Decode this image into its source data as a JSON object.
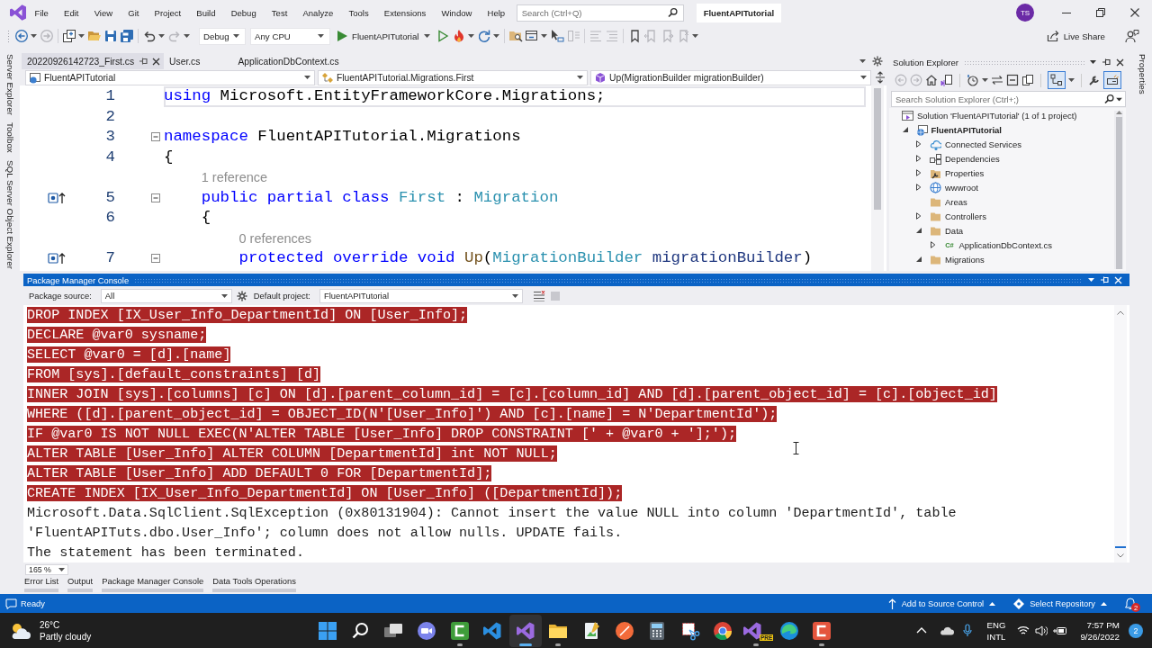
{
  "menu_bar": {
    "items": [
      "File",
      "Edit",
      "View",
      "Git",
      "Project",
      "Build",
      "Debug",
      "Test",
      "Analyze",
      "Tools",
      "Extensions",
      "Window",
      "Help"
    ],
    "search": {
      "placeholder": "Search (Ctrl+Q)"
    },
    "solution_name": "FluentAPITutorial",
    "account_initials": "TS"
  },
  "toolbar": {
    "back_button": {
      "disabled": false
    },
    "forward_button": {
      "disabled": true
    },
    "undo_button": {
      "disabled": false
    },
    "redo_button": {
      "disabled": true
    },
    "configuration": "Debug",
    "platform": "Any CPU",
    "startup_project": "FluentAPITutorial",
    "comment_buttons": [
      {
        "disabled": true
      },
      {
        "disabled": true
      }
    ],
    "bookmark_buttons": [
      {
        "disabled": false
      },
      {
        "disabled": true
      },
      {
        "disabled": true
      },
      {
        "disabled": true
      }
    ],
    "live_share": "Live Share"
  },
  "left_tool_strip": [
    "Server Explorer",
    "Toolbox",
    "SQL Server Object Explorer"
  ],
  "editor": {
    "tabs": [
      {
        "label": "20220926142723_First.cs",
        "selected": true
      },
      {
        "label": "User.cs",
        "selected": false
      },
      {
        "label": "ApplicationDbContext.cs",
        "selected": false
      }
    ],
    "navigation": [
      {
        "kind": "project",
        "text": "FluentAPITutorial"
      },
      {
        "kind": "class",
        "text": "FluentAPITutorial.Migrations.First"
      },
      {
        "kind": "method",
        "text": "Up(MigrationBuilder migrationBuilder)"
      }
    ],
    "lines": [
      {
        "kind": "code",
        "number": "1",
        "current": true,
        "glyph": false,
        "tokens": [
          {
            "kind": "keyword",
            "text": "using"
          },
          {
            "kind": "plain",
            "text": " Microsoft.EntityFrameworkCore.Migrations;"
          }
        ]
      },
      {
        "kind": "code",
        "number": "2",
        "current": false,
        "glyph": false
      },
      {
        "kind": "code",
        "number": "3",
        "current": false,
        "glyph": false,
        "expanded": true,
        "tokens": [
          {
            "kind": "keyword",
            "text": "namespace"
          },
          {
            "kind": "plain",
            "text": " FluentAPITutorial.Migrations"
          }
        ]
      },
      {
        "kind": "code",
        "number": "4",
        "current": false,
        "glyph": false,
        "tokens": [
          {
            "kind": "plain",
            "text": "{"
          }
        ]
      },
      {
        "kind": "codelens",
        "text": "    1 reference"
      },
      {
        "kind": "code",
        "number": "5",
        "current": false,
        "glyph": true,
        "expanded": true,
        "tokens": [
          {
            "kind": "keyword",
            "text": "    public partial class"
          },
          {
            "kind": "type",
            "text": " First"
          },
          {
            "kind": "plain",
            "text": " : "
          },
          {
            "kind": "type",
            "text": "Migration"
          }
        ]
      },
      {
        "kind": "code",
        "number": "6",
        "current": false,
        "glyph": false,
        "tokens": [
          {
            "kind": "plain",
            "text": "    {"
          }
        ]
      },
      {
        "kind": "codelens",
        "text": "        0 references"
      },
      {
        "kind": "code",
        "number": "7",
        "current": false,
        "glyph": true,
        "expanded": true,
        "tokens": [
          {
            "kind": "keyword",
            "text": "        protected override void"
          },
          {
            "kind": "method",
            "text": " Up"
          },
          {
            "kind": "plain",
            "text": "("
          },
          {
            "kind": "type",
            "text": "MigrationBuilder"
          },
          {
            "kind": "param",
            "text": " migrationBuilder"
          },
          {
            "kind": "plain",
            "text": ")"
          }
        ]
      }
    ]
  },
  "solution_explorer": {
    "title": "Solution Explorer",
    "toolbar": {
      "back_button": {
        "disabled": true
      },
      "forward_button": {
        "disabled": true
      },
      "toggle_buttons": [
        {
          "on": true
        },
        {
          "on": true
        }
      ]
    },
    "search": {
      "placeholder": "Search Solution Explorer (Ctrl+;)"
    },
    "tree": [
      {
        "kind": "solution",
        "label": "Solution 'FluentAPITutorial' (1 of 1 project)",
        "children": [
          {
            "kind": "project",
            "label": "FluentAPITutorial",
            "startup": true,
            "expanded": true,
            "children": [
              {
                "kind": "services",
                "label": "Connected Services",
                "expanded": false
              },
              {
                "kind": "dependencies",
                "label": "Dependencies",
                "expanded": false
              },
              {
                "kind": "properties",
                "label": "Properties",
                "expanded": false
              },
              {
                "kind": "webroot",
                "label": "wwwroot",
                "expanded": false
              },
              {
                "kind": "folder",
                "label": "Areas"
              },
              {
                "kind": "folder",
                "label": "Controllers",
                "expanded": false
              },
              {
                "kind": "folder",
                "label": "Data",
                "expanded": true,
                "children": [
                  {
                    "kind": "csharp",
                    "label": "ApplicationDbContext.cs",
                    "file_badge": "C#",
                    "expanded": false
                  }
                ]
              },
              {
                "kind": "folder",
                "label": "Migrations",
                "expanded": true
              }
            ]
          }
        ]
      }
    ]
  },
  "right_tool_strip": [
    "Properties"
  ],
  "package_manager_console": {
    "title": "Package Manager Console",
    "package_source_label": "Package source:",
    "package_source": "All",
    "default_project_label": "Default project:",
    "default_project": "FluentAPITutorial",
    "stop_button": {
      "disabled": true
    },
    "output": [
      {
        "highlighted": true,
        "text": "DROP INDEX [IX_User_Info_DepartmentId] ON [User_Info];"
      },
      {
        "highlighted": true,
        "text": "DECLARE @var0 sysname;"
      },
      {
        "highlighted": true,
        "text": "SELECT @var0 = [d].[name]"
      },
      {
        "highlighted": true,
        "text": "FROM [sys].[default_constraints] [d]"
      },
      {
        "highlighted": true,
        "text": "INNER JOIN [sys].[columns] [c] ON [d].[parent_column_id] = [c].[column_id] AND [d].[parent_object_id] = [c].[object_id]"
      },
      {
        "highlighted": true,
        "text": "WHERE ([d].[parent_object_id] = OBJECT_ID(N'[User_Info]') AND [c].[name] = N'DepartmentId');"
      },
      {
        "highlighted": true,
        "text": "IF @var0 IS NOT NULL EXEC(N'ALTER TABLE [User_Info] DROP CONSTRAINT [' + @var0 + '];');"
      },
      {
        "highlighted": true,
        "text": "ALTER TABLE [User_Info] ALTER COLUMN [DepartmentId] int NOT NULL;"
      },
      {
        "highlighted": true,
        "text": "ALTER TABLE [User_Info] ADD DEFAULT 0 FOR [DepartmentId];"
      },
      {
        "highlighted": true,
        "text": "CREATE INDEX [IX_User_Info_DepartmentId] ON [User_Info] ([DepartmentId]);"
      },
      {
        "highlighted": false,
        "text": "Microsoft.Data.SqlClient.SqlException (0x80131904): Cannot insert the value NULL into column 'DepartmentId', table"
      },
      {
        "highlighted": false,
        "text": "'FluentAPITuts.dbo.User_Info'; column does not allow nulls. UPDATE fails."
      },
      {
        "highlighted": false,
        "text": "The statement has been terminated."
      }
    ],
    "zoom": "165 %"
  },
  "bottom_tabs": [
    "Error List",
    "Output",
    "Package Manager Console",
    "Data Tools Operations"
  ],
  "status_bar": {
    "message": "Ready",
    "source_control": "Add to Source Control",
    "repository": "Select Repository",
    "notification_count": "2"
  },
  "taskbar": {
    "weather": {
      "temperature": "26°C",
      "condition": "Partly cloudy"
    },
    "apps": [
      {
        "kind": "start",
        "running": false,
        "active": false
      },
      {
        "kind": "search",
        "running": false,
        "active": false
      },
      {
        "kind": "taskview",
        "running": false,
        "active": false
      },
      {
        "kind": "chat",
        "running": false,
        "active": false
      },
      {
        "kind": "recorder",
        "color": "#3f9d3a",
        "running": true,
        "active": false
      },
      {
        "kind": "editor",
        "running": false,
        "active": false
      },
      {
        "kind": "ide",
        "running": true,
        "active": true
      },
      {
        "kind": "folder",
        "running": true,
        "active": false
      },
      {
        "kind": "sketch",
        "running": false,
        "active": false
      },
      {
        "kind": "disc",
        "running": false,
        "active": false
      },
      {
        "kind": "calculator",
        "running": false,
        "active": false
      },
      {
        "kind": "snip",
        "running": false,
        "active": false
      },
      {
        "kind": "browser",
        "running": false,
        "active": false
      },
      {
        "kind": "ide",
        "badge": "PRE",
        "running": true,
        "active": false
      },
      {
        "kind": "wave",
        "running": false,
        "active": false
      },
      {
        "kind": "recorder",
        "color": "#e4553d",
        "running": true,
        "active": false
      }
    ],
    "tray": {
      "language": "ENG",
      "keyboard": "INTL",
      "time": "7:57 PM",
      "date": "9/26/2022",
      "notification_count": "2"
    }
  }
}
